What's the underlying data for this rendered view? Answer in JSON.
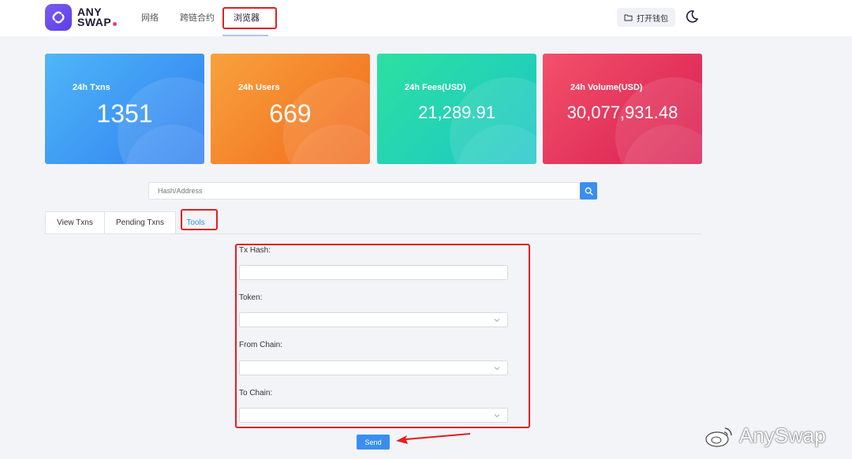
{
  "header": {
    "logo_line1": "ANY",
    "logo_line2": "SWAP",
    "nav": [
      "网络",
      "跨链合约",
      "浏览器"
    ],
    "wallet_label": "打开钱包"
  },
  "stats": [
    {
      "label": "24h Txns",
      "value": "1351"
    },
    {
      "label": "24h Users",
      "value": "669"
    },
    {
      "label": "24h Fees(USD)",
      "value": "21,289.91"
    },
    {
      "label": "24h Volume(USD)",
      "value": "30,077,931.48"
    }
  ],
  "search": {
    "placeholder": "Hash/Address"
  },
  "tabs": [
    "View Txns",
    "Pending Txns",
    "Tools"
  ],
  "form": {
    "fields": [
      {
        "label": "Tx Hash:"
      },
      {
        "label": "Token:"
      },
      {
        "label": "From Chain:"
      },
      {
        "label": "To Chain:"
      }
    ],
    "send_label": "Send"
  },
  "watermark": "AnySwap",
  "colors": {
    "accent": "#3a8ef0",
    "highlight": "#e02020"
  }
}
